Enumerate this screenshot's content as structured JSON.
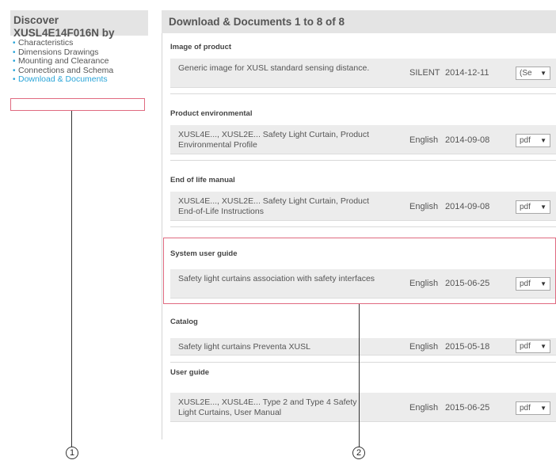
{
  "sidebar": {
    "title_line1": "Discover",
    "title_line2": "XUSL4E14F016N by",
    "items": [
      {
        "label": "Characteristics"
      },
      {
        "label": "Dimensions Drawings"
      },
      {
        "label": "Mounting and Clearance"
      },
      {
        "label": "Connections and Schema"
      },
      {
        "label": "Download & Documents"
      }
    ],
    "active_index": 4
  },
  "main": {
    "header": "Download & Documents 1 to 8 of 8",
    "sections": [
      {
        "title": "Image of product",
        "desc": "Generic image for XUSL standard sensing distance.",
        "lang": "SILENT",
        "date": "2014-12-11",
        "format": "(Se"
      },
      {
        "title": "Product environmental",
        "desc": "XUSL4E..., XUSL2E... Safety Light Curtain, Product Environmental Profile",
        "lang": "English",
        "date": "2014-09-08",
        "format": "pdf"
      },
      {
        "title": "End of life manual",
        "desc": "XUSL4E..., XUSL2E... Safety Light Curtain, Product End-of-Life Instructions",
        "lang": "English",
        "date": "2014-09-08",
        "format": "pdf"
      },
      {
        "title": "System user guide",
        "desc": "Safety light curtains association with safety interfaces",
        "lang": "English",
        "date": "2015-06-25",
        "format": "pdf"
      },
      {
        "title": "Catalog",
        "desc": "Safety light curtains Preventa XUSL",
        "lang": "English",
        "date": "2015-05-18",
        "format": "pdf"
      },
      {
        "title": "User guide",
        "desc": "XUSL2E..., XUSL4E... Type 2 and Type 4 Safety Light Curtains, User Manual",
        "lang": "English",
        "date": "2015-06-25",
        "format": "pdf"
      }
    ]
  },
  "callouts": {
    "left": "1",
    "right": "2"
  },
  "colors": {
    "accent": "#2aa5d8",
    "highlight": "#e06a80",
    "panel": "#e4e4e4",
    "row": "#ececec"
  },
  "icons": {
    "bullet": "bullet-icon",
    "dropdown": "caret-down-icon"
  }
}
